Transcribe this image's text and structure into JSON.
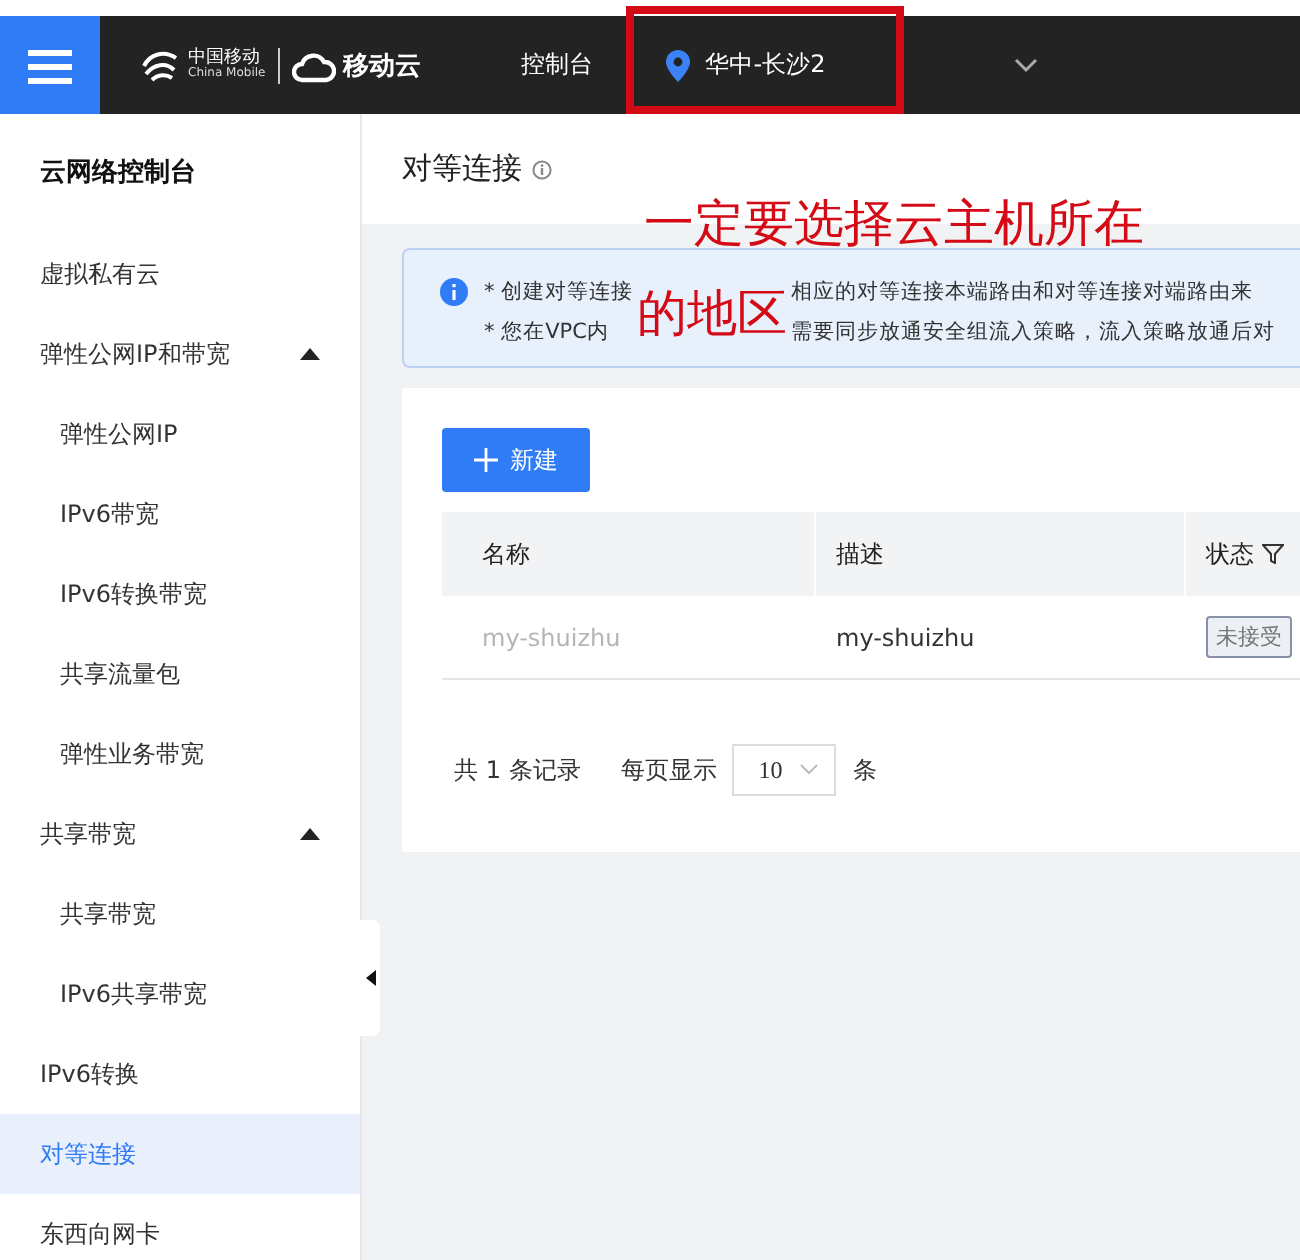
{
  "topbar": {
    "logo": {
      "cn": "中国移动",
      "en": "China Mobile",
      "cloud": "移动云"
    },
    "nav": "控制台",
    "region": "华中-长沙2"
  },
  "sidebar": {
    "title": "云网络控制台",
    "items": [
      {
        "label": "虚拟私有云",
        "selected": false
      },
      {
        "label": "弹性公网IP和带宽",
        "selected": false,
        "expanded": true,
        "children": [
          {
            "label": "弹性公网IP",
            "selected": false
          },
          {
            "label": "IPv6带宽",
            "selected": false
          },
          {
            "label": "IPv6转换带宽",
            "selected": false
          },
          {
            "label": "共享流量包",
            "selected": false
          },
          {
            "label": "弹性业务带宽",
            "selected": false
          }
        ]
      },
      {
        "label": "共享带宽",
        "selected": false,
        "expanded": true,
        "children": [
          {
            "label": "共享带宽",
            "selected": false
          },
          {
            "label": "IPv6共享带宽",
            "selected": false
          }
        ]
      },
      {
        "label": "IPv6转换",
        "selected": false
      },
      {
        "label": "对等连接",
        "selected": true
      },
      {
        "label": "东西向网卡",
        "selected": false
      }
    ]
  },
  "page": {
    "title": "对等连接",
    "notice": [
      {
        "segments": [
          "* 创建对等连接",
          "相应的对等连接本端路由和对等连接对端路由来"
        ]
      },
      {
        "segments": [
          "* 您在VPC内",
          "需要同步放通安全组流入策略，流入策略放通后对"
        ]
      }
    ],
    "new_button": "新建",
    "table": {
      "columns": [
        "名称",
        "描述",
        "状态"
      ],
      "rows": [
        {
          "name": "my-shuizhu",
          "description": "my-shuizhu",
          "status": "未接受"
        }
      ]
    },
    "pagination": {
      "total": "共 1 条记录",
      "per_page_label": "每页显示",
      "per_page": "10",
      "unit": "条"
    }
  },
  "annotation": {
    "lines": [
      "一定要选择云主机所在",
      "的地区"
    ]
  }
}
